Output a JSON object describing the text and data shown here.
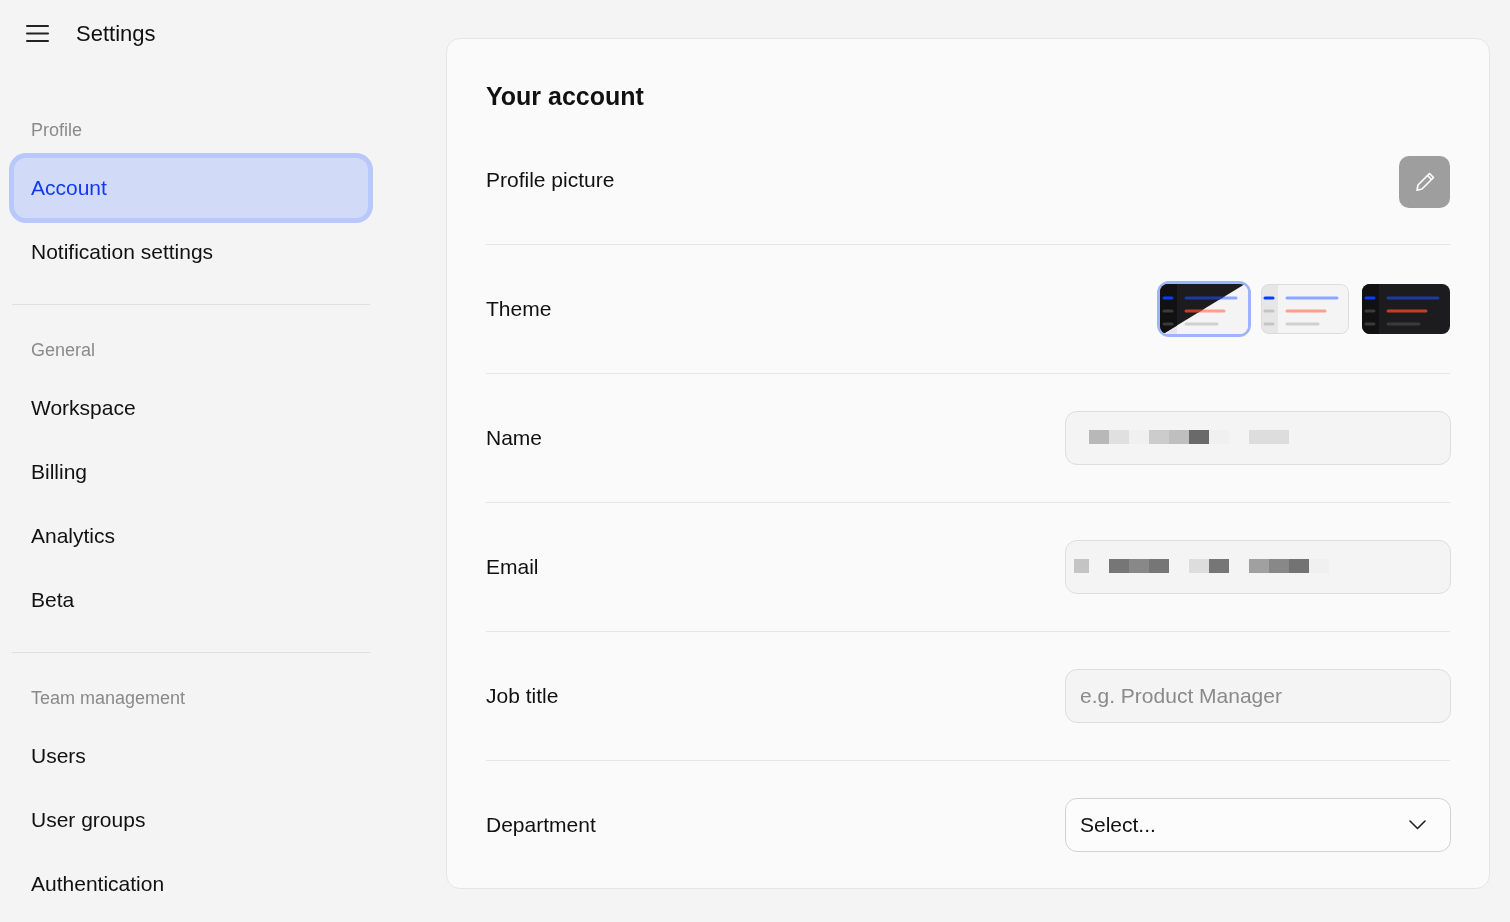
{
  "header": {
    "title": "Settings"
  },
  "sidebar": {
    "sections": [
      {
        "title": "Profile",
        "items": [
          {
            "label": "Account",
            "selected": true
          },
          {
            "label": "Notification settings",
            "selected": false
          }
        ]
      },
      {
        "title": "General",
        "items": [
          {
            "label": "Workspace",
            "selected": false
          },
          {
            "label": "Billing",
            "selected": false
          },
          {
            "label": "Analytics",
            "selected": false
          },
          {
            "label": "Beta",
            "selected": false
          }
        ]
      },
      {
        "title": "Team management",
        "items": [
          {
            "label": "Users",
            "selected": false
          },
          {
            "label": "User groups",
            "selected": false
          },
          {
            "label": "Authentication",
            "selected": false
          }
        ]
      }
    ]
  },
  "account": {
    "title": "Your account",
    "rows": [
      {
        "kind": "avatar",
        "label": "Profile picture"
      },
      {
        "kind": "theme",
        "label": "Theme",
        "options": [
          {
            "kind": "system",
            "selected": true
          },
          {
            "kind": "light",
            "selected": false
          },
          {
            "kind": "dark",
            "selected": false
          }
        ]
      },
      {
        "kind": "text",
        "label": "Name",
        "redacted": true
      },
      {
        "kind": "text",
        "label": "Email",
        "redacted": true
      },
      {
        "kind": "text",
        "label": "Job title",
        "redacted": false,
        "placeholder": "e.g. Product Manager"
      },
      {
        "kind": "select",
        "label": "Department",
        "value": "Select..."
      }
    ]
  }
}
